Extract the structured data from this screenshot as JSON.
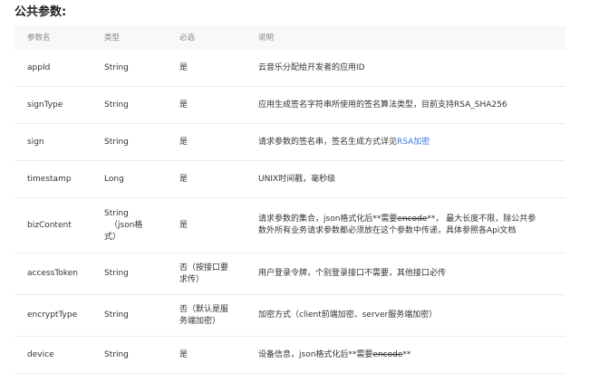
{
  "title": "公共参数:",
  "headers": {
    "name": "参数名",
    "type": "类型",
    "required": "必选",
    "desc": "说明"
  },
  "rows": [
    {
      "name": "appId",
      "type": "String",
      "required": "是",
      "desc": "云音乐分配给开发者的应用ID"
    },
    {
      "name": "signType",
      "type": "String",
      "required": "是",
      "desc": "应用生成签名字符串所使用的签名算法类型，目前支持RSA_SHA256"
    },
    {
      "name": "sign",
      "type": "String",
      "required": "是",
      "desc_prefix": "请求参数的签名串，签名生成方式详见",
      "desc_link": "RSA加密"
    },
    {
      "name": "timestamp",
      "type": "Long",
      "required": "是",
      "desc": "UNIX时间戳，毫秒级"
    },
    {
      "name": "bizContent",
      "type_line1": "String",
      "type_line2": "（json格",
      "type_line3": "式）",
      "required": "是",
      "desc_a": "请求参数的集合，json格式化后**需要",
      "desc_strike": "encode",
      "desc_b": "**， 最大长度不限，除公共参",
      "desc_line2": "数外所有业务请求参数都必须放在这个参数中传递，具体参照各Api文档"
    },
    {
      "name": "accessToken",
      "type": "String",
      "required_line1": "否（按接口要",
      "required_line2": "求传）",
      "desc": "用户登录令牌，个别登录接口不需要，其他接口必传"
    },
    {
      "name": "encryptType",
      "type": "String",
      "required_line1": "否（默认是服",
      "required_line2": "务端加密）",
      "desc": "加密方式（client前端加密、server服务端加密）"
    },
    {
      "name": "device",
      "type": "String",
      "required": "是",
      "desc_a": "设备信息，json格式化后**需要",
      "desc_strike": "encode",
      "desc_b": "**"
    }
  ]
}
